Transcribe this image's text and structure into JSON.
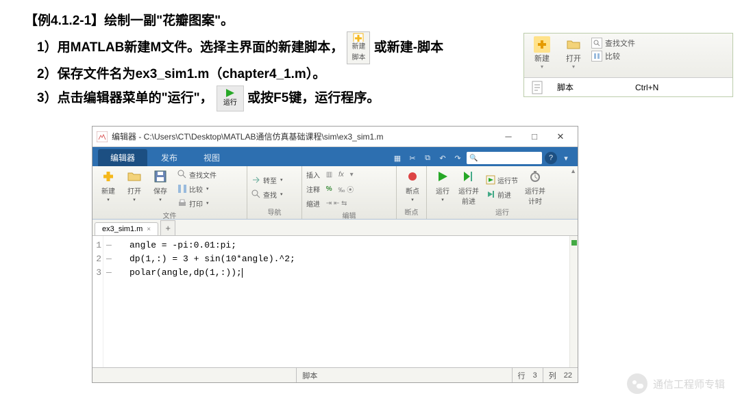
{
  "title": "【例4.1.2-1】绘制一副\"花瓣图案\"。",
  "steps": {
    "s1a": "1）用MATLAB新建M文件。选择主界面的新建脚本，",
    "s1b": "或新建-脚本",
    "s2": "2）保存文件名为ex3_sim1.m（chapter4_1.m）。",
    "s3a": "3）点击编辑器菜单的\"运行\"，",
    "s3b": "或按F5键，运行程序。"
  },
  "inline_btn": {
    "new_script": "新建\n脚本",
    "run": "运行"
  },
  "right_panel": {
    "new": "新建",
    "open": "打开",
    "find_files": "查找文件",
    "compare": "比较",
    "script": "脚本",
    "shortcut": "Ctrl+N"
  },
  "editor": {
    "window_title": "编辑器 - C:\\Users\\CT\\Desktop\\MATLAB通信仿真基础课程\\sim\\ex3_sim1.m",
    "tabs": {
      "editor": "编辑器",
      "publish": "发布",
      "view": "视图"
    },
    "ribbon": {
      "file": {
        "new": "新建",
        "open": "打开",
        "save": "保存",
        "find_files": "查找文件",
        "compare": "比较",
        "print": "打印",
        "group": "文件"
      },
      "nav": {
        "goto": "转至",
        "find": "查找",
        "group": "导航"
      },
      "edit": {
        "insert": "插入",
        "comment": "注释",
        "indent": "缩进",
        "fx": "fx",
        "pct": "%",
        "group": "编辑"
      },
      "bp": {
        "breakpoints": "断点",
        "group": "断点"
      },
      "run": {
        "run": "运行",
        "run_advance": "运行并\n前进",
        "run_section": "运行节",
        "advance": "前进",
        "run_time": "运行并\n计时",
        "group": "运行"
      }
    },
    "file_tab": "ex3_sim1.m",
    "code": {
      "l1": "angle = -pi:0.01:pi;",
      "l2": "dp(1,:) = 3 + sin(10*angle).^2;",
      "l3": "polar(angle,dp(1,:));"
    },
    "status": {
      "type": "脚本",
      "line_lbl": "行",
      "line_val": "3",
      "col_lbl": "列",
      "col_val": "22"
    }
  },
  "watermark": "通信工程师专辑"
}
